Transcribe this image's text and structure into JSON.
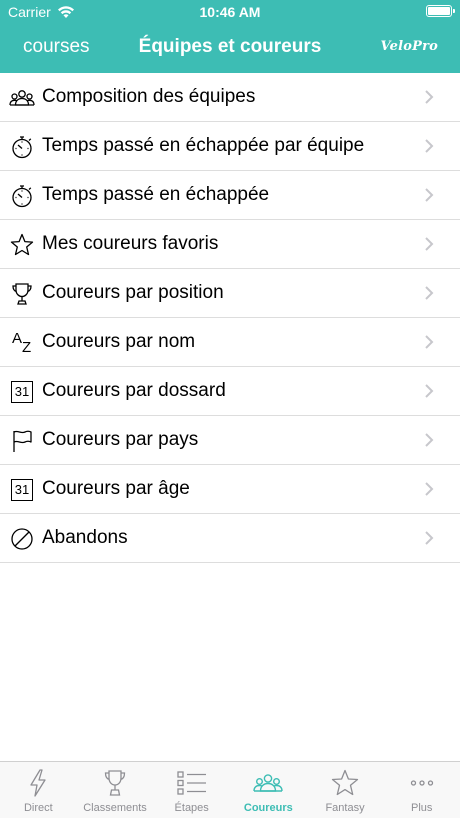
{
  "status": {
    "carrier": "Carrier",
    "time": "10:46 AM"
  },
  "nav": {
    "back_label": "courses",
    "title": "Équipes et coureurs",
    "logo": "VeloPro"
  },
  "menu": {
    "items": [
      {
        "label": "Composition des équipes",
        "icon": "team-icon"
      },
      {
        "label": "Temps passé en échappée par équipe",
        "icon": "stopwatch-icon"
      },
      {
        "label": "Temps passé en échappée",
        "icon": "stopwatch-icon"
      },
      {
        "label": "Mes coureurs favoris",
        "icon": "star-icon"
      },
      {
        "label": "Coureurs par position",
        "icon": "trophy-icon"
      },
      {
        "label": "Coureurs par nom",
        "icon": "sort-az-icon"
      },
      {
        "label": "Coureurs par dossard",
        "icon": "calendar-31-icon"
      },
      {
        "label": "Coureurs par pays",
        "icon": "flag-icon"
      },
      {
        "label": "Coureurs par âge",
        "icon": "calendar-31-icon"
      },
      {
        "label": "Abandons",
        "icon": "forbidden-icon"
      }
    ],
    "az_top": "A",
    "az_bottom": "Z",
    "calendar_day": "31"
  },
  "tabs": [
    {
      "label": "Direct",
      "icon": "lightning-icon",
      "active": false
    },
    {
      "label": "Classements",
      "icon": "trophy-icon",
      "active": false
    },
    {
      "label": "Étapes",
      "icon": "list-icon",
      "active": false
    },
    {
      "label": "Coureurs",
      "icon": "team-icon",
      "active": true
    },
    {
      "label": "Fantasy",
      "icon": "star-icon",
      "active": false
    },
    {
      "label": "Plus",
      "icon": "more-icon",
      "active": false
    }
  ],
  "colors": {
    "accent": "#3dbdb4",
    "inactive": "#8e8e93",
    "separator": "#dddddd",
    "chevron": "#c7c7cc"
  }
}
